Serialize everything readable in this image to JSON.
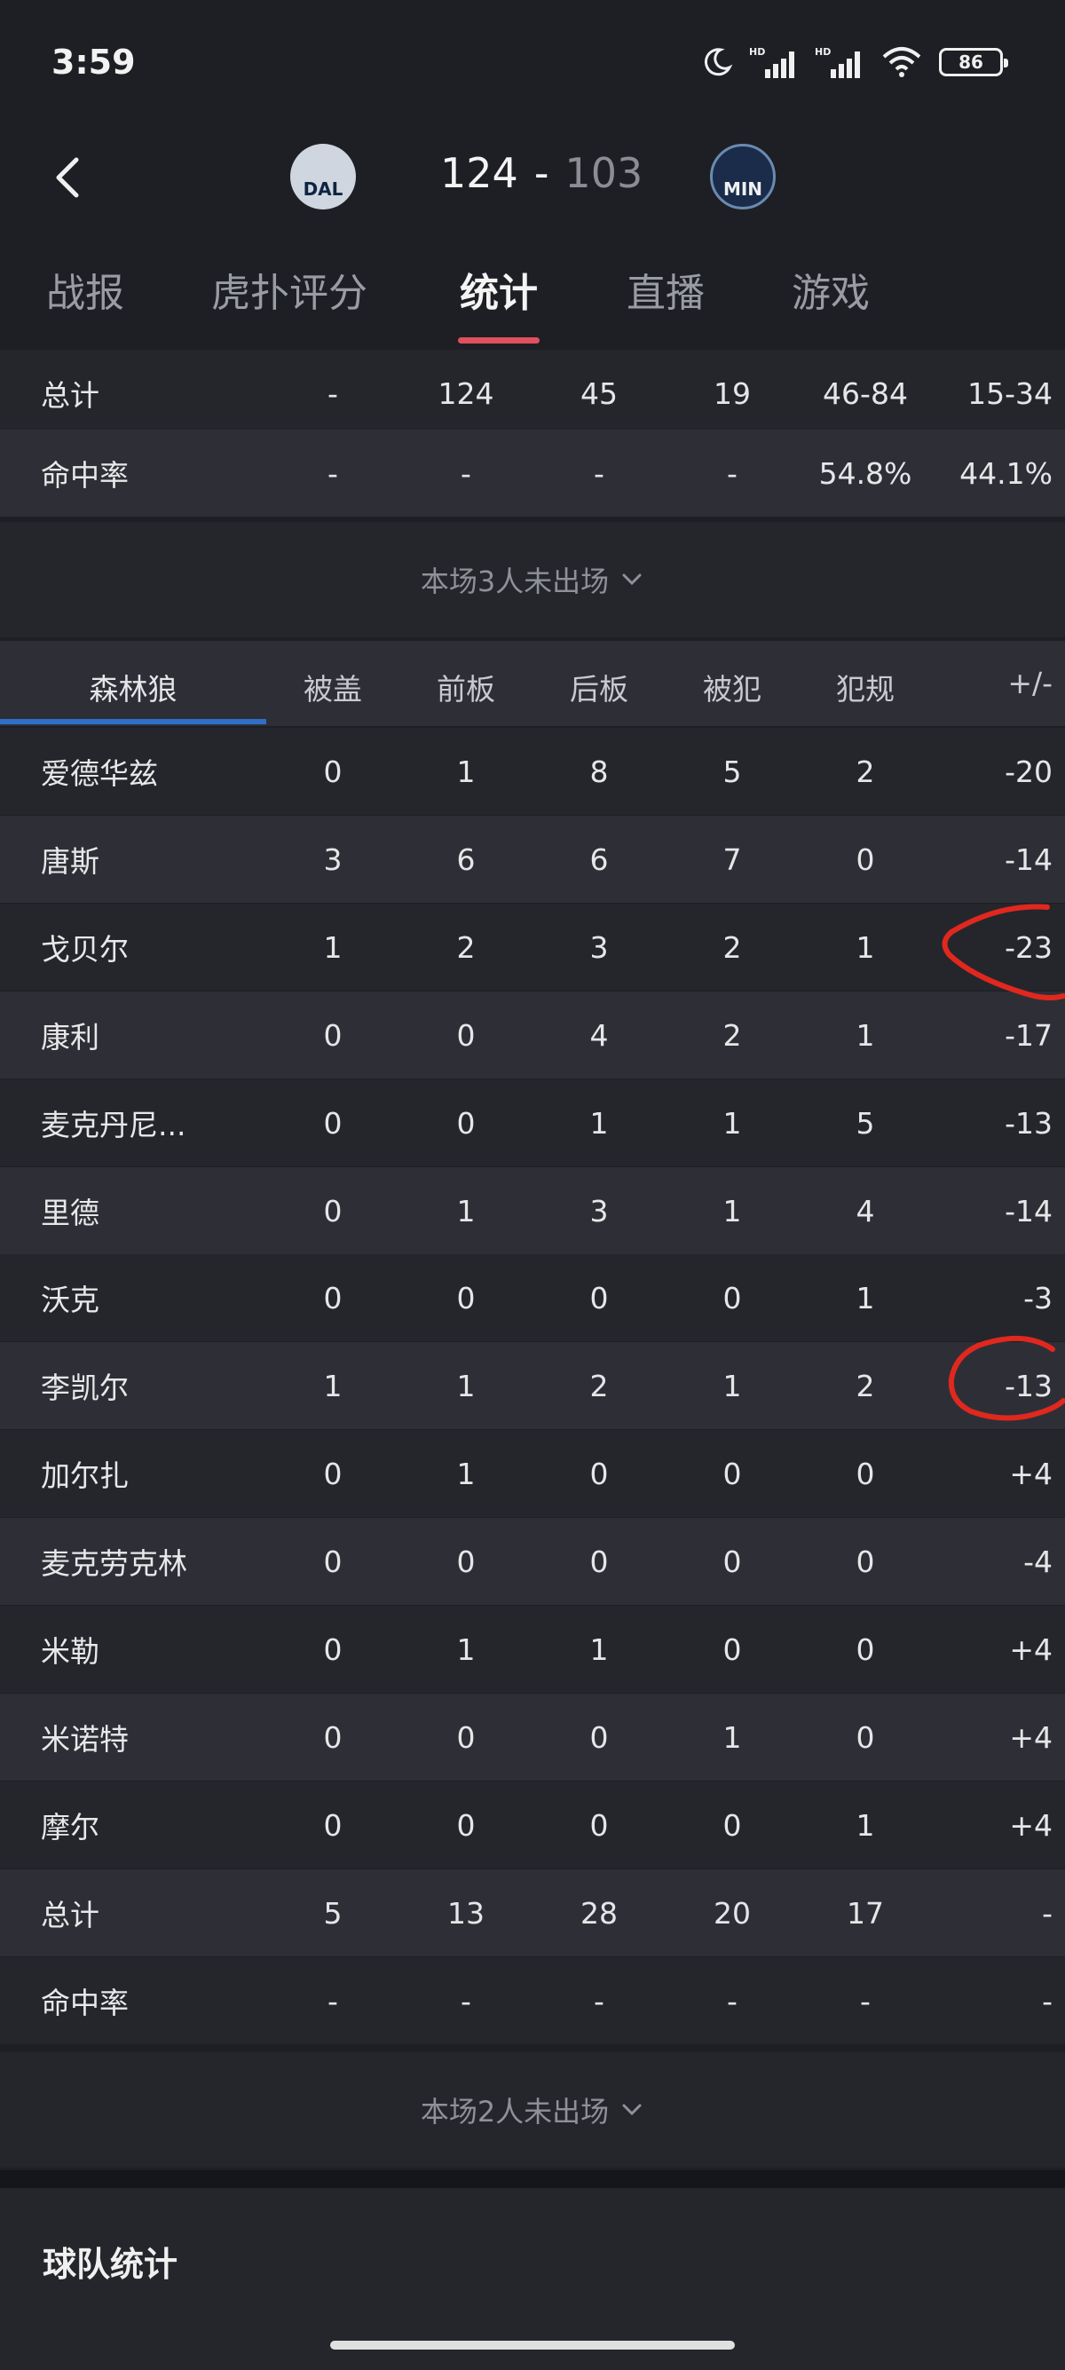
{
  "status": {
    "time": "3:59",
    "battery": "86",
    "signal_label": "HD"
  },
  "header": {
    "home_team_abbr": "DAL",
    "away_team_abbr": "MIN",
    "home_score": "124",
    "separator": "-",
    "away_score": "103"
  },
  "tabs": [
    {
      "label": "战报"
    },
    {
      "label": "虎扑评分"
    },
    {
      "label": "统计",
      "active": true
    },
    {
      "label": "直播"
    },
    {
      "label": "游戏"
    }
  ],
  "dal_summary": [
    {
      "name": "总计",
      "values": [
        "-",
        "124",
        "45",
        "19",
        "46-84",
        "15-34"
      ]
    },
    {
      "name": "命中率",
      "values": [
        "-",
        "-",
        "-",
        "-",
        "54.8%",
        "44.1%"
      ]
    }
  ],
  "dal_absent": "本场3人未出场",
  "min_table": {
    "team_name": "森林狼",
    "columns": [
      "被盖",
      "前板",
      "后板",
      "被犯",
      "犯规",
      "+/-"
    ],
    "players": [
      {
        "name": "爱德华兹",
        "values": [
          "0",
          "1",
          "8",
          "5",
          "2",
          "-20"
        ]
      },
      {
        "name": "唐斯",
        "values": [
          "3",
          "6",
          "6",
          "7",
          "0",
          "-14"
        ]
      },
      {
        "name": "戈贝尔",
        "values": [
          "1",
          "2",
          "3",
          "2",
          "1",
          "-23"
        ]
      },
      {
        "name": "康利",
        "values": [
          "0",
          "0",
          "4",
          "2",
          "1",
          "-17"
        ]
      },
      {
        "name": "麦克丹尼...",
        "values": [
          "0",
          "0",
          "1",
          "1",
          "5",
          "-13"
        ]
      },
      {
        "name": "里德",
        "values": [
          "0",
          "1",
          "3",
          "1",
          "4",
          "-14"
        ]
      },
      {
        "name": "沃克",
        "values": [
          "0",
          "0",
          "0",
          "0",
          "1",
          "-3"
        ]
      },
      {
        "name": "李凯尔",
        "values": [
          "1",
          "1",
          "2",
          "1",
          "2",
          "-13"
        ]
      },
      {
        "name": "加尔扎",
        "values": [
          "0",
          "1",
          "0",
          "0",
          "0",
          "+4"
        ]
      },
      {
        "name": "麦克劳克林",
        "values": [
          "0",
          "0",
          "0",
          "0",
          "0",
          "-4"
        ]
      },
      {
        "name": "米勒",
        "values": [
          "0",
          "1",
          "1",
          "0",
          "0",
          "+4"
        ]
      },
      {
        "name": "米诺特",
        "values": [
          "0",
          "0",
          "0",
          "1",
          "0",
          "+4"
        ]
      },
      {
        "name": "摩尔",
        "values": [
          "0",
          "0",
          "0",
          "0",
          "1",
          "+4"
        ]
      }
    ],
    "totals": [
      {
        "name": "总计",
        "values": [
          "5",
          "13",
          "28",
          "20",
          "17",
          "-"
        ]
      },
      {
        "name": "命中率",
        "values": [
          "-",
          "-",
          "-",
          "-",
          "-",
          "-"
        ]
      }
    ]
  },
  "min_absent": "本场2人未出场",
  "team_stats_title": "球队统计",
  "colors": {
    "accent": "#e0505f",
    "team_underline": "#2f6fc7",
    "annotation": "#e0281e"
  }
}
